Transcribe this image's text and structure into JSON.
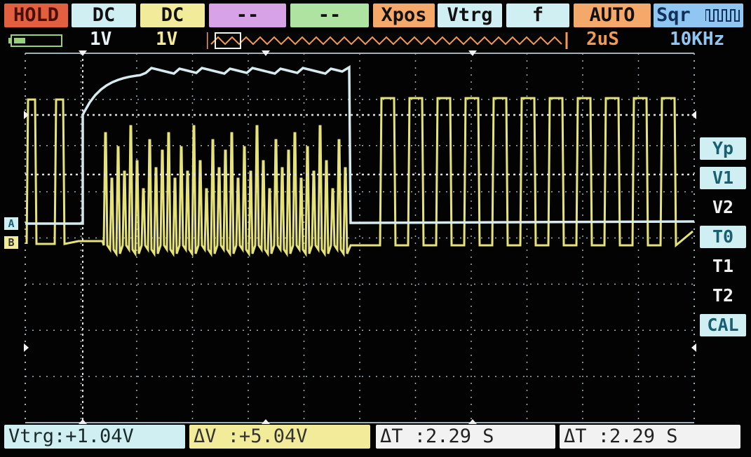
{
  "topbar": {
    "hold": "HOLD",
    "ch1_coupling": "DC",
    "ch2_coupling": "DC",
    "math1": "--",
    "math2": "--",
    "xpos": "Xpos",
    "vtrg": "Vtrg",
    "f": "f",
    "mode": "AUTO",
    "sqr": "Sqr"
  },
  "scales": {
    "ch1": "1V",
    "ch2": "1V",
    "timebase": "2uS",
    "frequency": "10KHz"
  },
  "right_menu": {
    "yp": "Yp",
    "v1": "V1",
    "v2": "V2",
    "t0": "T0",
    "t1": "T1",
    "t2": "T2",
    "cal": "CAL"
  },
  "markers": {
    "a": "A",
    "b": "B"
  },
  "bottombar": {
    "vtrg": "Vtrg:+1.04V",
    "dv": "ΔV :+5.04V",
    "dt1": "ΔT :2.29 S",
    "dt2": "ΔT :2.29 S"
  },
  "colors": {
    "ch_a": "#d6ebf0",
    "ch_b": "#e6e27a",
    "grid": "#9fb0b8",
    "hold": "#e2603f",
    "timebase": "#f49a4f",
    "freq": "#8fc7f2"
  },
  "icons": {
    "battery": "battery-icon",
    "sqr_wave": "square-wave-icon"
  }
}
